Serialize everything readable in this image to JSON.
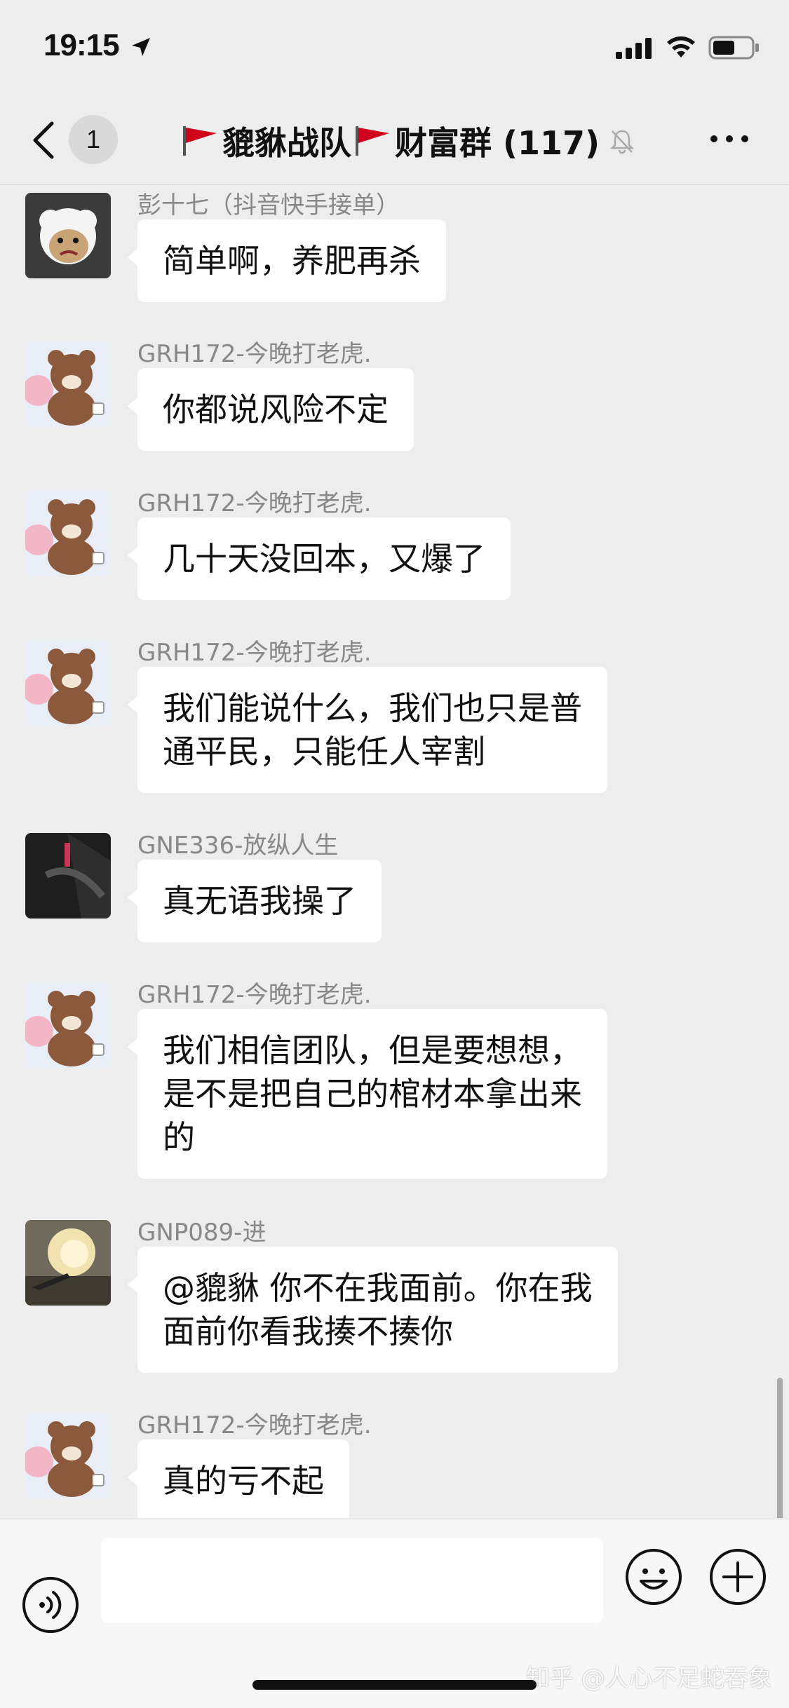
{
  "status_bar": {
    "time": "19:15"
  },
  "nav": {
    "unread_count": "1",
    "title_part1": "貔貅战队",
    "title_part2": "财富群 (117)"
  },
  "messages": [
    {
      "sender": "彭十七（抖音快手接单）",
      "lines": [
        "简单啊，养肥再杀"
      ],
      "avatar": "sheep-avatar"
    },
    {
      "sender": "GRH172-今晚打老虎.",
      "lines": [
        "你都说风险不定"
      ],
      "avatar": "bear-avatar"
    },
    {
      "sender": "GRH172-今晚打老虎.",
      "lines": [
        "几十天没回本，又爆了"
      ],
      "avatar": "bear-avatar"
    },
    {
      "sender": "GRH172-今晚打老虎.",
      "lines": [
        "我们能说什么，我们也只是普",
        "通平民，只能任人宰割"
      ],
      "avatar": "bear-avatar"
    },
    {
      "sender": "GNE336-放纵人生",
      "lines": [
        "真无语我操了"
      ],
      "avatar": "dark-photo-avatar"
    },
    {
      "sender": "GRH172-今晚打老虎.",
      "lines": [
        "我们相信团队，但是要想想，",
        "是不是把自己的棺材本拿出来",
        "的"
      ],
      "avatar": "bear-avatar"
    },
    {
      "sender": "GNP089-进",
      "lines": [
        "@貔貅  你不在我面前。你在我",
        "面前你看我揍不揍你"
      ],
      "avatar": "explosion-photo-avatar"
    },
    {
      "sender": "GRH172-今晚打老虎.",
      "lines": [
        "真的亏不起"
      ],
      "avatar": "bear-avatar"
    }
  ],
  "input": {
    "value": "",
    "placeholder": ""
  },
  "watermark": "知乎 @人心不足蛇吞象",
  "colors": {
    "background": "#ededed",
    "bubble": "#ffffff",
    "flag": "#d0021b"
  }
}
